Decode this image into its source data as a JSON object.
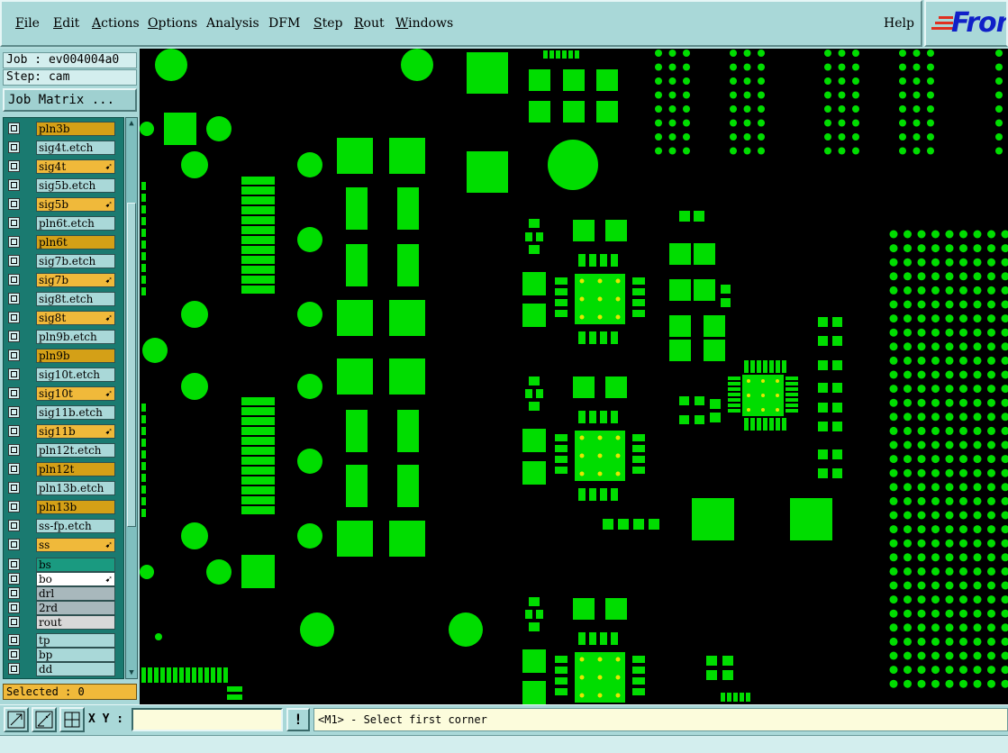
{
  "menubar": {
    "items": [
      {
        "label": "File",
        "underline": "F"
      },
      {
        "label": "Edit",
        "underline": "E"
      },
      {
        "label": "Actions",
        "underline": "A"
      },
      {
        "label": "Options",
        "underline": "O"
      },
      {
        "label": "Analysis",
        "underline": ""
      },
      {
        "label": "DFM",
        "underline": ""
      },
      {
        "label": "Step",
        "underline": "S"
      },
      {
        "label": "Rout",
        "underline": "R"
      },
      {
        "label": "Windows",
        "underline": "W"
      }
    ],
    "help": "Help"
  },
  "logo": {
    "text": "Fron",
    "color": "#1020c8"
  },
  "job_field": "Job : ev004004a0",
  "step_field": "Step: cam",
  "job_matrix_button": "Job Matrix ...",
  "layers": [
    {
      "name": "pln3b",
      "color": "#d4a017",
      "arrow": false
    },
    {
      "name": "sig4t.etch",
      "color": "#a9d8d8",
      "arrow": false
    },
    {
      "name": "sig4t",
      "color": "#f0b93a",
      "arrow": true
    },
    {
      "name": "sig5b.etch",
      "color": "#a9d8d8",
      "arrow": false
    },
    {
      "name": "sig5b",
      "color": "#f0b93a",
      "arrow": true
    },
    {
      "name": "pln6t.etch",
      "color": "#a9d8d8",
      "arrow": false
    },
    {
      "name": "pln6t",
      "color": "#d4a017",
      "arrow": false
    },
    {
      "name": "sig7b.etch",
      "color": "#a9d8d8",
      "arrow": false
    },
    {
      "name": "sig7b",
      "color": "#f0b93a",
      "arrow": true
    },
    {
      "name": "sig8t.etch",
      "color": "#a9d8d8",
      "arrow": false
    },
    {
      "name": "sig8t",
      "color": "#f0b93a",
      "arrow": true
    },
    {
      "name": "pln9b.etch",
      "color": "#a9d8d8",
      "arrow": false
    },
    {
      "name": "pln9b",
      "color": "#d4a017",
      "arrow": false
    },
    {
      "name": "sig10t.etch",
      "color": "#a9d8d8",
      "arrow": false
    },
    {
      "name": "sig10t",
      "color": "#f0b93a",
      "arrow": true
    },
    {
      "name": "sig11b.etch",
      "color": "#a9d8d8",
      "arrow": false
    },
    {
      "name": "sig11b",
      "color": "#f0b93a",
      "arrow": true
    },
    {
      "name": "pln12t.etch",
      "color": "#a9d8d8",
      "arrow": false
    },
    {
      "name": "pln12t",
      "color": "#d4a017",
      "arrow": false
    },
    {
      "name": "pln13b.etch",
      "color": "#a9d8d8",
      "arrow": false
    },
    {
      "name": "pln13b",
      "color": "#d4a017",
      "arrow": false
    },
    {
      "name": "ss-fp.etch",
      "color": "#a9d8d8",
      "arrow": false
    },
    {
      "name": "ss",
      "color": "#f0b93a",
      "arrow": true
    },
    {
      "name": "bs",
      "color": "#1a9a80",
      "arrow": false
    },
    {
      "name": "bo",
      "color": "#ffffff",
      "arrow": true
    },
    {
      "name": "drl",
      "color": "#a8b8bc",
      "arrow": false
    },
    {
      "name": "2rd",
      "color": "#a8b8bc",
      "arrow": false
    },
    {
      "name": "rout",
      "color": "#d8d8d8",
      "arrow": false
    },
    {
      "name": "tp",
      "color": "#a9d8d8",
      "arrow": false
    },
    {
      "name": "bp",
      "color": "#a9d8d8",
      "arrow": false
    },
    {
      "name": "dd",
      "color": "#a9d8d8",
      "arrow": false
    }
  ],
  "selected_field": "Selected : 0",
  "xy_label": "X Y :",
  "xy_input_value": "",
  "status_message": "<M1> - Select first corner",
  "excl_button": "!",
  "icons": {
    "tool1": "zoom-fit-icon",
    "tool2": "measure-icon",
    "tool3": "grid-snap-icon"
  },
  "colors": {
    "pad": "#00dd00",
    "pad_center": "#e6e600",
    "canvas": "#000000"
  }
}
